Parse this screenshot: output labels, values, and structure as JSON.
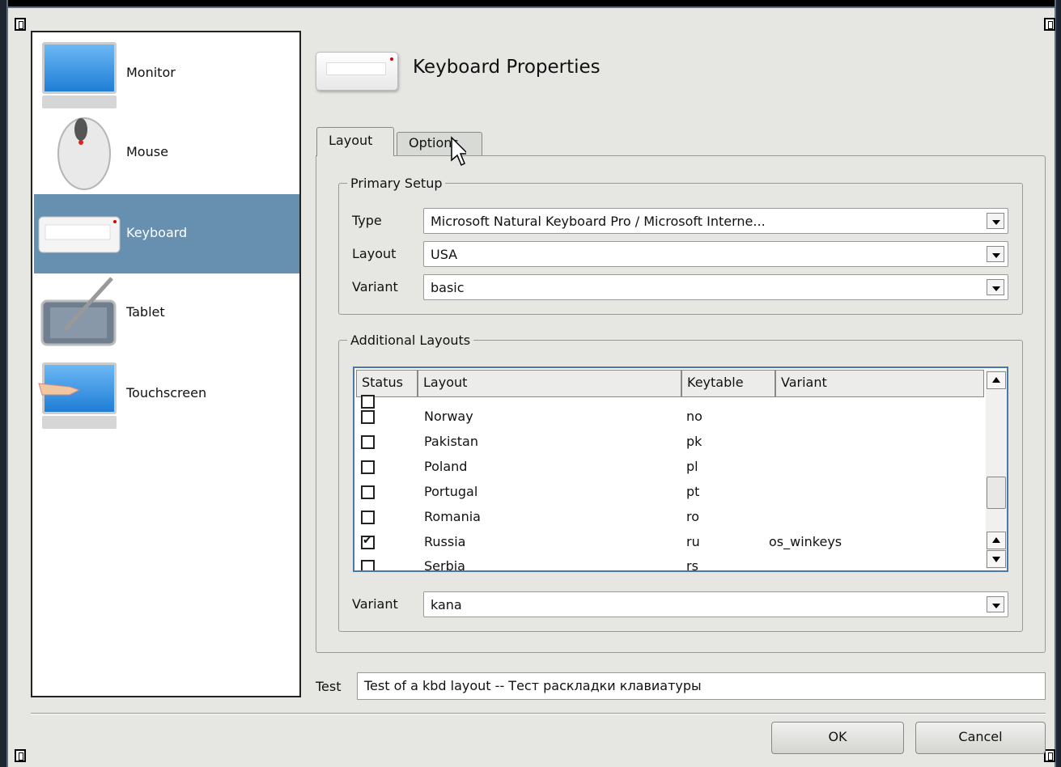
{
  "devices": [
    {
      "label": "Monitor",
      "icon": "monitor-icon"
    },
    {
      "label": "Mouse",
      "icon": "mouse-icon"
    },
    {
      "label": "Keyboard",
      "icon": "keyboard-icon",
      "selected": true
    },
    {
      "label": "Tablet",
      "icon": "tablet-icon"
    },
    {
      "label": "Touchscreen",
      "icon": "touchscreen-icon"
    }
  ],
  "header": {
    "title": "Keyboard Properties"
  },
  "tabs": [
    {
      "label": "Layout",
      "active": true
    },
    {
      "label": "Options",
      "active": false
    }
  ],
  "primary": {
    "legend": "Primary Setup",
    "type_label": "Type",
    "type_value": "Microsoft Natural Keyboard Pro / Microsoft Interne...",
    "layout_label": "Layout",
    "layout_value": "USA",
    "variant_label": "Variant",
    "variant_value": "basic"
  },
  "additional": {
    "legend": "Additional Layouts",
    "columns": [
      "Status",
      "Layout",
      "Keytable",
      "Variant"
    ],
    "rows": [
      {
        "checked": false,
        "layout": "Norway",
        "keytable": "no",
        "variant": ""
      },
      {
        "checked": false,
        "layout": "Pakistan",
        "keytable": "pk",
        "variant": ""
      },
      {
        "checked": false,
        "layout": "Poland",
        "keytable": "pl",
        "variant": ""
      },
      {
        "checked": false,
        "layout": "Portugal",
        "keytable": "pt",
        "variant": ""
      },
      {
        "checked": false,
        "layout": "Romania",
        "keytable": "ro",
        "variant": ""
      },
      {
        "checked": true,
        "layout": "Russia",
        "keytable": "ru",
        "variant": "os_winkeys"
      },
      {
        "checked": false,
        "layout": "Serbia",
        "keytable": "rs",
        "variant": ""
      }
    ],
    "variant_label": "Variant",
    "variant_value": "kana"
  },
  "test": {
    "label": "Test",
    "value": "Test of a kbd layout  --  Тест раскладки клавиатуры"
  },
  "buttons": {
    "ok": "OK",
    "cancel": "Cancel"
  },
  "colors": {
    "selection": "#6790b0",
    "table_focus": "#4a78a8"
  }
}
